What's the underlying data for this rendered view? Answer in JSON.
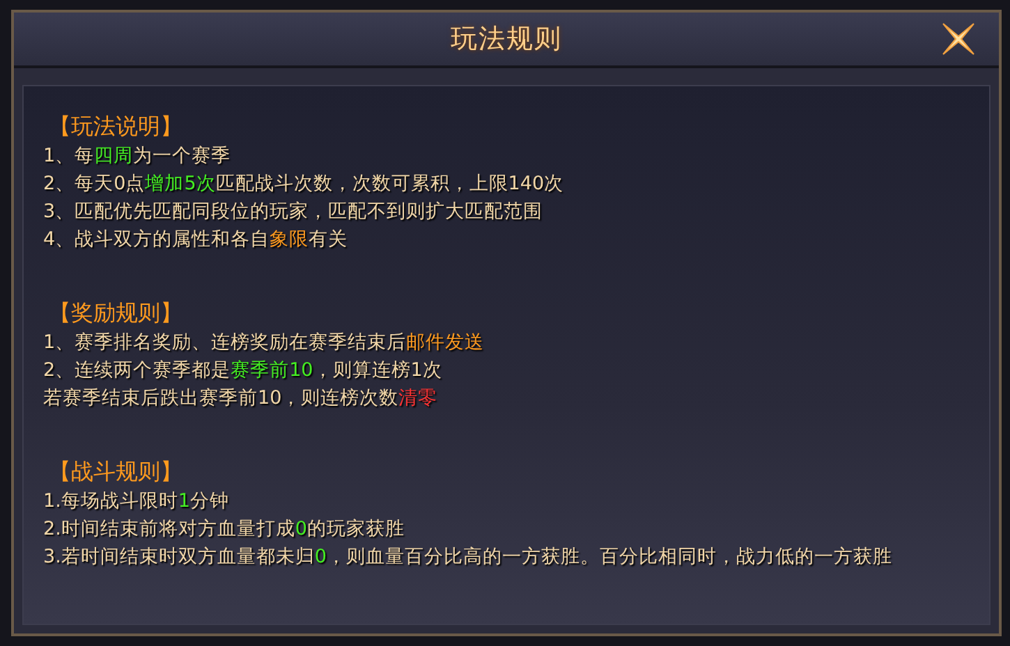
{
  "window": {
    "title": "玩法规则"
  },
  "sections": [
    {
      "heading": "【玩法说明】",
      "lines": [
        [
          {
            "text": "1、每"
          },
          {
            "text": "四周",
            "color": "#44ee22"
          },
          {
            "text": "为一个赛季"
          }
        ],
        [
          {
            "text": "2、每天0点"
          },
          {
            "text": "增加5次",
            "color": "#44ee22"
          },
          {
            "text": "匹配战斗次数，次数可累积，上限140次"
          }
        ],
        [
          {
            "text": "3、匹配优先匹配同段位的玩家，匹配不到则扩大匹配范围"
          }
        ],
        [
          {
            "text": "4、战斗双方的属性和各自"
          },
          {
            "text": "象限",
            "color": "#ff9a1e"
          },
          {
            "text": "有关"
          }
        ]
      ]
    },
    {
      "heading": "【奖励规则】",
      "lines": [
        [
          {
            "text": "1、赛季排名奖励、连榜奖励在赛季结束后"
          },
          {
            "text": "邮件发送",
            "color": "#ff9a1e"
          }
        ],
        [
          {
            "text": "2、连续两个赛季都是"
          },
          {
            "text": "赛季前10",
            "color": "#44ee22"
          },
          {
            "text": "，则算连榜1次"
          }
        ],
        [
          {
            "text": "若赛季结束后跌出赛季前10，则连榜次数"
          },
          {
            "text": "清零",
            "color": "#ff3333"
          }
        ]
      ]
    },
    {
      "heading": "【战斗规则】",
      "lines": [
        [
          {
            "text": "1.每场战斗限时"
          },
          {
            "text": "1",
            "color": "#44ee22"
          },
          {
            "text": "分钟"
          }
        ],
        [
          {
            "text": "2.时间结束前将对方血量打成"
          },
          {
            "text": "0",
            "color": "#44ee22"
          },
          {
            "text": "的玩家获胜"
          }
        ],
        [
          {
            "text": "3.若时间结束时双方血量都未归"
          },
          {
            "text": "0",
            "color": "#44ee22"
          },
          {
            "text": "，则血量百分比高的一方获胜。百分比相同时，战力低的一方获胜"
          }
        ]
      ]
    }
  ]
}
